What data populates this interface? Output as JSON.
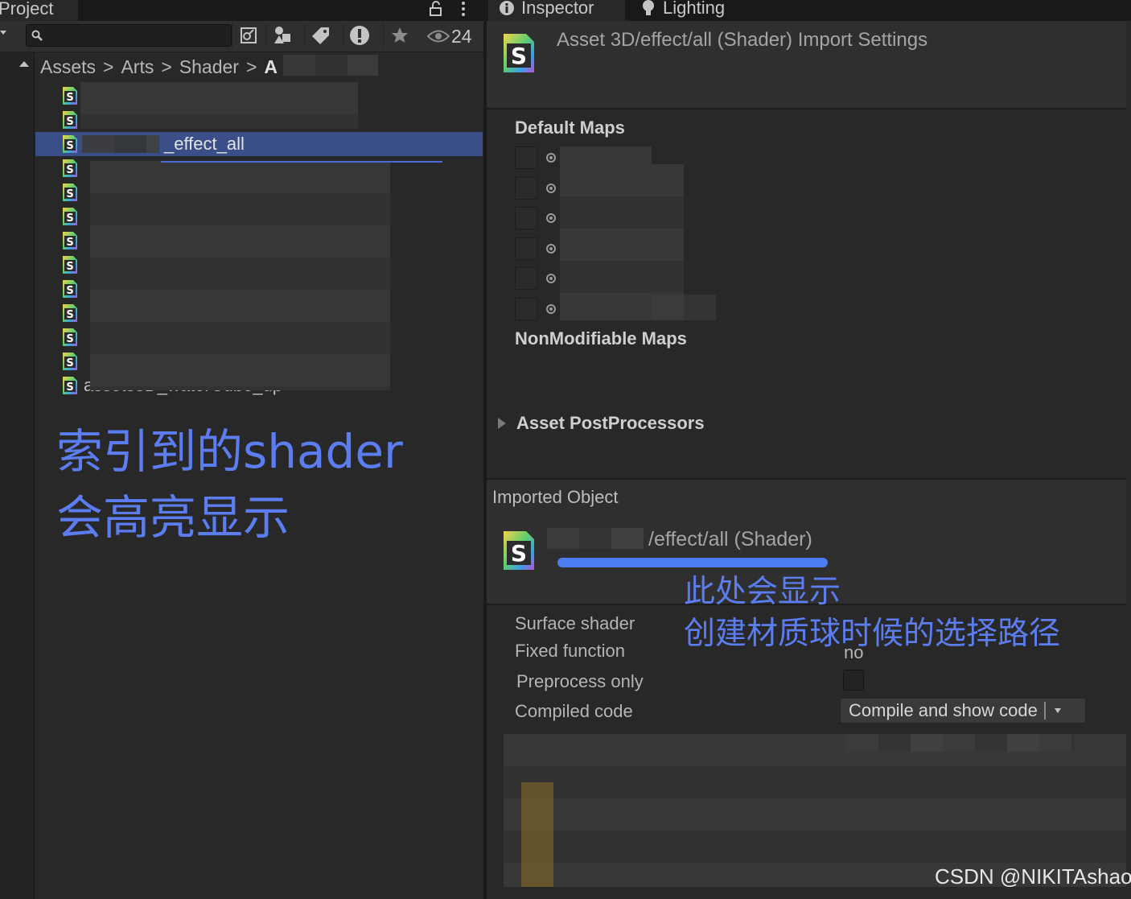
{
  "project_panel": {
    "tab_label": "Project",
    "search": {
      "value": "",
      "placeholder": ""
    },
    "hidden_count": "24",
    "breadcrumb": [
      "Assets",
      "Arts",
      "Shader",
      "A"
    ],
    "breadcrumb_separator": ">",
    "selected_file": "_effect_all",
    "partial_file": "assets3D_waterCube_up",
    "annotation": [
      "索引到的shader",
      "会高亮显示"
    ]
  },
  "inspector": {
    "tabs": [
      {
        "label": "Inspector",
        "icon": "info-icon"
      },
      {
        "label": "Lighting",
        "icon": "lightbulb-icon"
      }
    ],
    "title": "Asset 3D/effect/all (Shader) Import Settings",
    "default_maps_label": "Default Maps",
    "nonmodifiable_maps_label": "NonModifiable Maps",
    "asset_postprocessors_label": "Asset PostProcessors",
    "imported_object_label": "Imported Object",
    "imported_object_name": "/effect/all (Shader)",
    "annotation": [
      "此处会显示",
      "创建材质球时候的选择路径"
    ],
    "properties": {
      "surface_shader_label": "Surface shader",
      "fixed_function_label": "Fixed function",
      "fixed_function_value": "no",
      "preprocess_only_label": "Preprocess only",
      "compiled_code_label": "Compiled code",
      "compile_button_label": "Compile and show code"
    }
  },
  "colors": {
    "annotation_blue": "#5b7df0",
    "selection_blue": "#3a4f87",
    "panel_bg": "#282828"
  },
  "watermark": "CSDN @NIKITAshao"
}
